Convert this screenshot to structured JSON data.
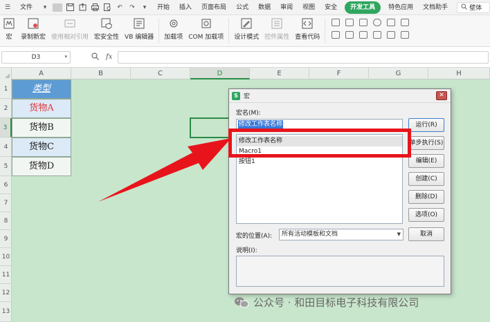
{
  "menubar": {
    "file_label": "文件",
    "tabs": [
      "开始",
      "插入",
      "页面布局",
      "公式",
      "数据",
      "审阅",
      "视图",
      "安全"
    ],
    "active_tab": "开发工具",
    "tabs_after": [
      "特色应用",
      "文档助手"
    ],
    "search_label": "壁体"
  },
  "ribbon": {
    "buttons": [
      {
        "label": "宏",
        "icon": "macro-icon",
        "disabled": false
      },
      {
        "label": "录制新宏",
        "icon": "record-macro-icon",
        "disabled": false
      },
      {
        "label": "使用相对引用",
        "icon": "relative-ref-icon",
        "disabled": true
      },
      {
        "label": "宏安全性",
        "icon": "macro-security-icon",
        "disabled": false
      },
      {
        "label": "VB 编辑器",
        "icon": "vb-editor-icon",
        "disabled": false
      },
      {
        "label": "加载项",
        "icon": "addin-icon",
        "disabled": false
      },
      {
        "label": "COM 加载项",
        "icon": "com-addin-icon",
        "disabled": false
      },
      {
        "label": "设计模式",
        "icon": "design-mode-icon",
        "disabled": false
      },
      {
        "label": "控件属性",
        "icon": "control-props-icon",
        "disabled": true
      },
      {
        "label": "查看代码",
        "icon": "view-code-icon",
        "disabled": false
      }
    ]
  },
  "formula_bar": {
    "name_box": "D3",
    "fx_label": "fx",
    "value": ""
  },
  "sheet": {
    "columns": [
      "A",
      "B",
      "C",
      "D",
      "E",
      "F",
      "G",
      "H"
    ],
    "selected_column": "D",
    "rows": [
      "1",
      "2",
      "3",
      "4",
      "5",
      "6",
      "7",
      "8",
      "9",
      "10",
      "11",
      "12",
      "13"
    ],
    "selected_row": "3",
    "cells": {
      "a1": "类型",
      "a2": "货物A",
      "a3": "货物B",
      "a4": "货物C",
      "a5": "货物D"
    },
    "colors": {
      "header_bg": "#5d9bd5",
      "accent_red": "#e0383b",
      "selection": "#2b8a45",
      "sheet_bg": "#c8e6cc"
    }
  },
  "dialog": {
    "title": "宏",
    "macro_name_label": "宏名(M):",
    "macro_name_value": "修改工作表名称",
    "macro_list": [
      "修改工作表名称",
      "Macro1",
      "按钮1"
    ],
    "buttons": {
      "run": "运行(R)",
      "step": "单步执行(S)",
      "edit": "编辑(E)",
      "create": "创建(C)",
      "delete": "删除(D)",
      "options": "选项(O)",
      "cancel": "取消"
    },
    "location_label": "宏的位置(A):",
    "location_value": "所有活动模板和文档",
    "description_label": "说明(I):",
    "close_glyph": "✕"
  },
  "watermark": "公众号 · 和田目标电子科技有限公司"
}
